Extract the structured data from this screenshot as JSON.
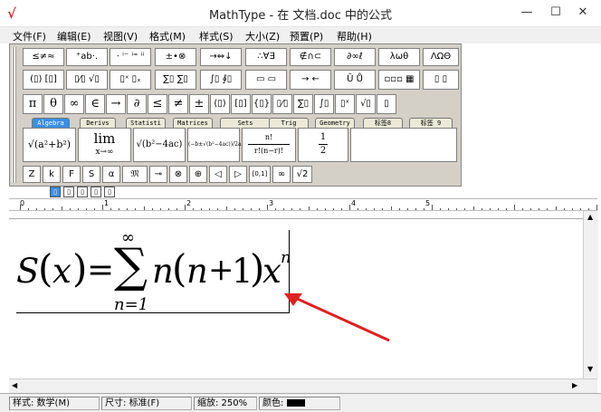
{
  "window": {
    "title": "MathType - 在 文档.doc 中的公式",
    "app_icon_glyph": "√",
    "min_glyph": "—",
    "max_glyph": "☐",
    "close_glyph": "✕"
  },
  "menu": [
    "文件(F)",
    "编辑(E)",
    "视图(V)",
    "格式(M)",
    "样式(S)",
    "大小(Z)",
    "预置(P)",
    "帮助(H)"
  ],
  "toolbar": {
    "row1": [
      "≤≠≈",
      "⁺ab·.",
      "⋅ ⁱ⁻ ⁱ⁼ ⁱⁱ",
      "±•⊗",
      "→⇔↓",
      "∴∀∃",
      "∉∩⊂",
      "∂∞ℓ",
      "λωθ",
      "ΛΩΘ"
    ],
    "row2": [
      "(▯) [▯]",
      "▯⁄▯ √▯",
      "▯ˣ ▯ₓ",
      "∑▯ ∑▯",
      "∫▯ ∮▯",
      "▭ ▭",
      "→ ←",
      "Ū Ů",
      "▫▫▫ ▦",
      "▯ ▯"
    ],
    "row3": [
      "π",
      "θ",
      "∞",
      "∈",
      "→",
      "∂",
      "≤",
      "≠",
      "±",
      "(▯)",
      "[▯]",
      "{▯}",
      "▯⁄▯",
      "∑▯",
      "∫▯",
      "▯ˣ",
      "√▯",
      "▯"
    ],
    "tabs": [
      "Algebra",
      "Derivs",
      "Statisti",
      "Matrices",
      "Sets",
      "Trig",
      "Geometry",
      "标签8",
      "标签 9"
    ],
    "templates": [
      "√(a²+b²)",
      "lim",
      "x→∞",
      "√(b²−4ac)",
      "(−b±√(b²−4ac))/2a",
      "n!",
      "r!(n−r)!",
      "1",
      "2"
    ],
    "row5": [
      "Z",
      "k",
      "F",
      "S",
      "α",
      "𝔐",
      "⊸",
      "⊗",
      "⊕",
      "◁",
      "▷",
      "[0,1]",
      "∞",
      "√2"
    ]
  },
  "size_buttons": [
    "▯",
    "▯",
    "▯",
    "▯",
    "▯"
  ],
  "ruler": {
    "labels": [
      "0",
      "1",
      "2",
      "3",
      "4",
      "5"
    ]
  },
  "formula": {
    "lhs": "S",
    "paren_open": "(",
    "var": "x",
    "paren_close": ")",
    "eq": "=",
    "sum": "∑",
    "upper": "∞",
    "lower": "n=1",
    "n1": "n",
    "inner_open": "(",
    "n2": "n",
    "plus": "+",
    "one": "1",
    "inner_close": ")",
    "x2": "x",
    "exp": "n"
  },
  "status": {
    "style_label": "样式: 数学(M)",
    "size_label": "尺寸: 标准(F)",
    "zoom_label": "缩放: 250%",
    "color_label": "颜色:",
    "color_value": "#000000"
  },
  "annotation": {
    "arrow_color": "#e02020"
  }
}
